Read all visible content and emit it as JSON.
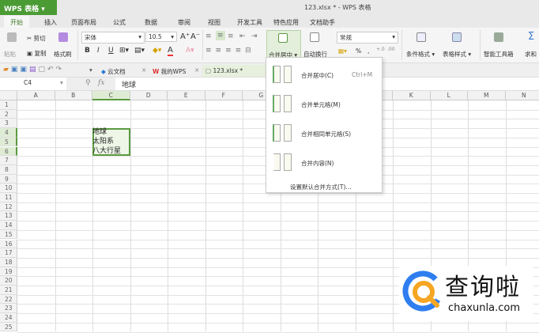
{
  "title_bar": {
    "app_button": "WPS 表格",
    "window_title": "123.xlsx * - WPS 表格"
  },
  "menu_tabs": [
    "开始",
    "插入",
    "页面布局",
    "公式",
    "数据",
    "审阅",
    "视图",
    "开发工具",
    "特色应用",
    "文档助手"
  ],
  "ribbon": {
    "paste": "粘贴",
    "cut": "剪切",
    "copy": "复制",
    "format_painter": "格式刷",
    "font_name": "宋体",
    "font_size": "10.5",
    "bold": "B",
    "italic": "I",
    "underline": "U",
    "merge_center": "合并居中",
    "wrap_text": "自动换行",
    "number_format": "常规",
    "percent": "%",
    "conditional_format": "条件格式",
    "table_style": "表格样式",
    "smart_toolbox": "智能工具箱",
    "sum": "求和"
  },
  "doc_tabs": [
    "云文档",
    "我的WPS",
    "123.xlsx *"
  ],
  "formula_bar": {
    "name_box": "C4",
    "fx": "fx",
    "value": "地球"
  },
  "columns": [
    "A",
    "B",
    "C",
    "D",
    "E",
    "F",
    "G",
    "H",
    "I",
    "J",
    "K",
    "L",
    "M",
    "N"
  ],
  "rows": [
    "1",
    "2",
    "3",
    "4",
    "5",
    "6",
    "7",
    "8",
    "9",
    "10",
    "11",
    "12",
    "13",
    "14",
    "15",
    "16",
    "17",
    "18",
    "19",
    "20",
    "21",
    "22",
    "23",
    "24",
    "25"
  ],
  "cells": {
    "C4": "地球",
    "C5": "太阳系",
    "C6": "八大行星"
  },
  "merge_menu": {
    "items": [
      {
        "label": "合并居中(C)",
        "shortcut": "Ctrl+M"
      },
      {
        "label": "合并单元格(M)"
      },
      {
        "label": "合并相同单元格(S)"
      },
      {
        "label": "合并内容(N)"
      }
    ],
    "footer": "设置默认合并方式(T)..."
  },
  "watermark": {
    "text": "查询啦",
    "url": "chaxunla.com"
  },
  "colors": {
    "accent": "#4b9b35",
    "selection": "#e3f0d8"
  }
}
